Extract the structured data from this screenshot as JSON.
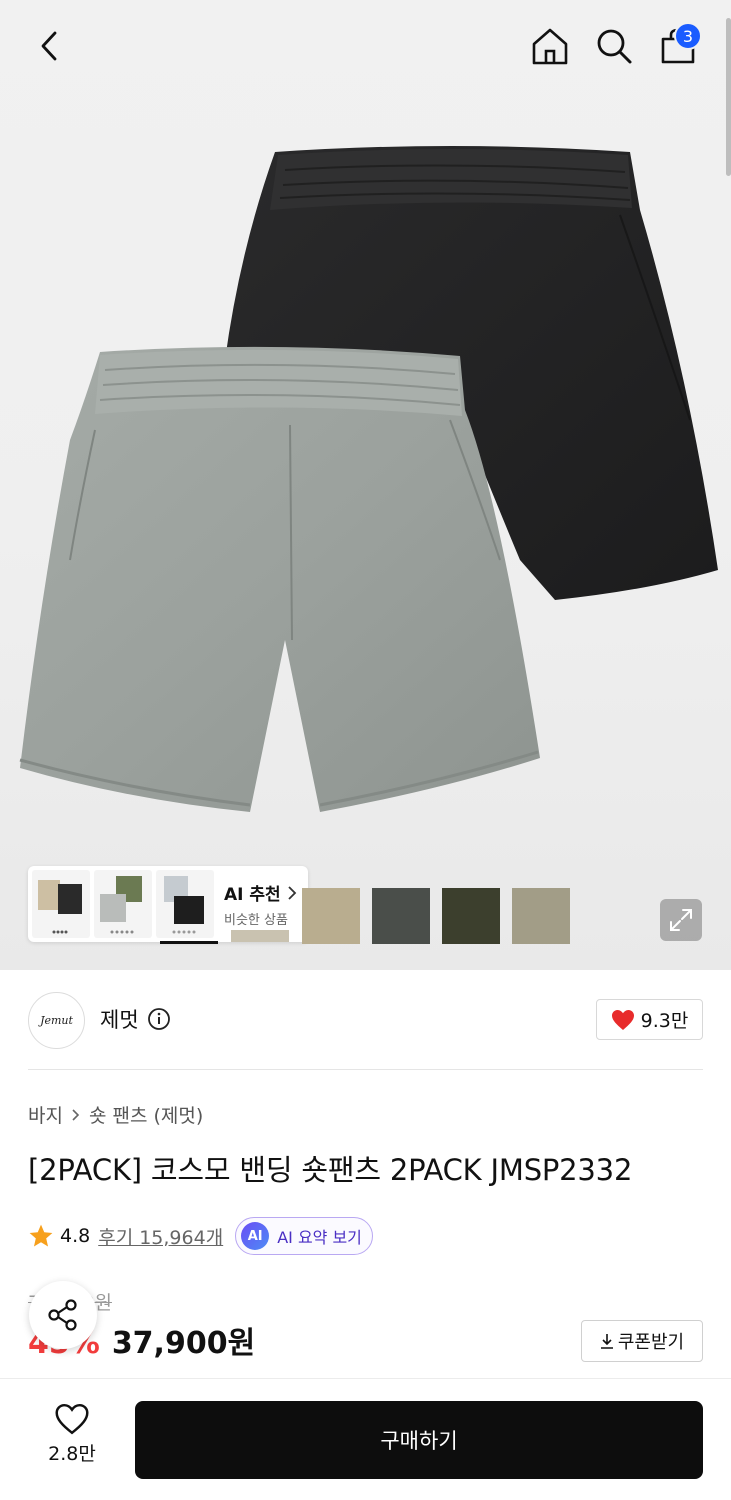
{
  "header": {
    "back_icon": "chevron-left-icon",
    "home_icon": "home-icon",
    "search_icon": "search-icon",
    "cart_icon": "shopping-bag-icon",
    "cart_count": "3"
  },
  "gallery": {
    "ai_recommend": {
      "title": "AI 추천",
      "subtitle": "비슷한 상품"
    },
    "swatch_colors": [
      "#c9c2b0",
      "#b9ad8f",
      "#4a4e4a",
      "#3c3f2d",
      "#a29d87"
    ],
    "expand_icon": "expand-icon"
  },
  "brand": {
    "logo_text": "Jemut",
    "name": "제멋",
    "info_icon": "info-icon",
    "like_count": "9.3만"
  },
  "breadcrumb": {
    "category": "바지",
    "subcategory": "숏 팬츠 (제멋)"
  },
  "product": {
    "title": "[2PACK] 코스모 밴딩 숏팬츠 2PACK JMSP2332",
    "rating": "4.8",
    "reviews_label": "후기 15,964개",
    "ai_summary_badge": "AI",
    "ai_summary_label": "AI 요약 보기",
    "original_price": "79,000원",
    "discount": "45%",
    "sale_price": "37,900원",
    "coupon_label": "쿠폰받기"
  },
  "bottom_bar": {
    "wish_count": "2.8만",
    "buy_label": "구매하기"
  },
  "colors": {
    "accent_blue": "#1a5cff",
    "discount_red": "#f23c3c",
    "heart_red": "#e82b2b",
    "ai_purple": "#4a2fc4"
  }
}
